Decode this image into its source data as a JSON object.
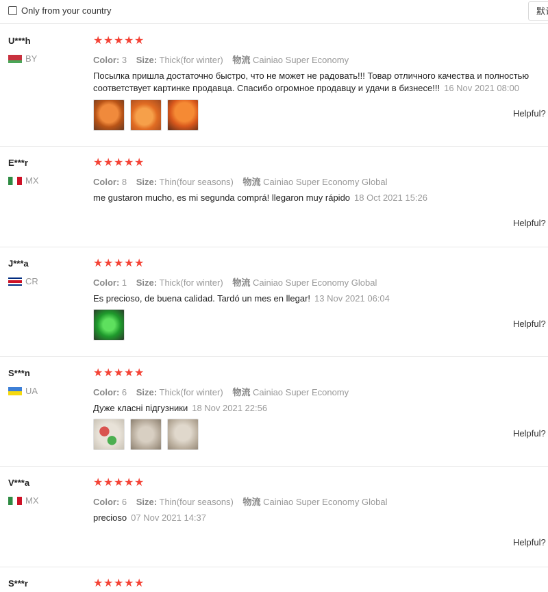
{
  "filter": {
    "label": "Only from your country"
  },
  "sort": {
    "label": "默认"
  },
  "labels": {
    "color": "Color:",
    "size": "Size:",
    "shipping": "物流",
    "helpful": "Helpful?"
  },
  "reviews": [
    {
      "user": "U***h",
      "country": "BY",
      "rating": 5,
      "color": "3",
      "size": "Thick(for winter)",
      "shipping": "Cainiao Super Economy",
      "text": "Посылка пришла достаточно быстро, что не может не радовать!!! Товар отличного качества и полностью соответствует картинке продавца. Спасибо огромное продавцу и удачи в бизнесе!!!",
      "date": "16 Nov 2021 08:00",
      "photos": [
        "orange-diaper-photo-1",
        "orange-diaper-photo-2",
        "orange-diaper-photo-3"
      ]
    },
    {
      "user": "E***r",
      "country": "MX",
      "rating": 5,
      "color": "8",
      "size": "Thin(four seasons)",
      "shipping": "Cainiao Super Economy Global",
      "text": "me gustaron mucho, es mi segunda comprá! llegaron muy rápido",
      "date": "18 Oct 2021 15:26",
      "photos": []
    },
    {
      "user": "J***a",
      "country": "CR",
      "rating": 5,
      "color": "1",
      "size": "Thick(for winter)",
      "shipping": "Cainiao Super Economy Global",
      "text": "Es precioso, de buena calidad. Tardó un mes en llegar!",
      "date": "13 Nov 2021 06:04",
      "photos": [
        "green-diaper-photo"
      ]
    },
    {
      "user": "S***n",
      "country": "UA",
      "rating": 5,
      "color": "6",
      "size": "Thick(for winter)",
      "shipping": "Cainiao Super Economy",
      "text": "Дуже класні підгузники",
      "date": "18 Nov 2021 22:56",
      "photos": [
        "diaper-set-photo-1",
        "diaper-set-photo-2",
        "diaper-set-photo-3"
      ]
    },
    {
      "user": "V***a",
      "country": "MX",
      "rating": 5,
      "color": "6",
      "size": "Thin(four seasons)",
      "shipping": "Cainiao Super Economy Global",
      "text": "precioso",
      "date": "07 Nov 2021 14:37",
      "photos": []
    },
    {
      "user": "S***r",
      "rating": 5
    }
  ]
}
